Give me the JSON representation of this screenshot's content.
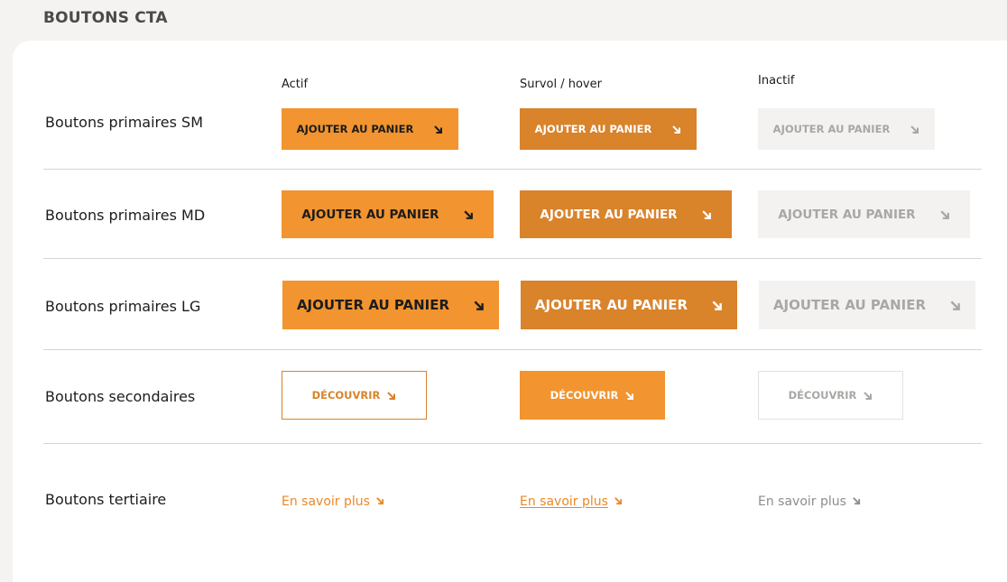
{
  "section_title": "BOUTONS CTA",
  "columns": {
    "active": "Actif",
    "hover": "Survol / hover",
    "disabled": "Inactif"
  },
  "rows": {
    "sm": "Boutons primaires SM",
    "md": "Boutons primaires MD",
    "lg": "Boutons primaires LG",
    "secondary": "Boutons secondaires",
    "tertiary": "Boutons tertiaire"
  },
  "buttons": {
    "primary_label": "AJOUTER AU PANIER",
    "secondary_label": "DÉCOUVRIR",
    "tertiary_label": "En savoir plus",
    "arrow_icon": "arrow-down-right-icon"
  },
  "colors": {
    "orange": "#f2942f",
    "orange_dark": "#d9832b",
    "disabled_bg": "#f3f2f0",
    "disabled_text": "#a9a7a4"
  }
}
